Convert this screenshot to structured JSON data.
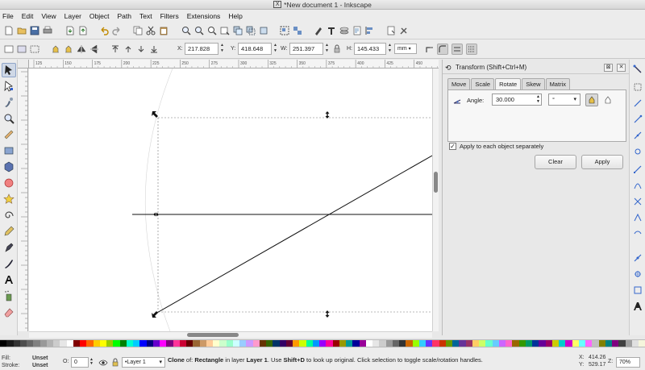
{
  "window": {
    "title": "*New document 1 - Inkscape"
  },
  "menu": [
    "File",
    "Edit",
    "View",
    "Layer",
    "Object",
    "Path",
    "Text",
    "Filters",
    "Extensions",
    "Help"
  ],
  "controls": {
    "x_label": "X:",
    "x_value": "217.828",
    "y_label": "Y:",
    "y_value": "418.648",
    "w_label": "W:",
    "w_value": "251.397",
    "h_label": "H:",
    "h_value": "145.433",
    "unit": "mm"
  },
  "ruler": {
    "h_ticks": [
      "125",
      "150",
      "175",
      "200",
      "225",
      "250",
      "275",
      "300",
      "325",
      "350",
      "375",
      "400",
      "425",
      "450"
    ]
  },
  "dock": {
    "title": "Transform (Shift+Ctrl+M)",
    "tabs": [
      "Move",
      "Scale",
      "Rotate",
      "Skew",
      "Matrix"
    ],
    "active_tab": "Rotate",
    "angle_label": "Angle:",
    "angle_value": "30.000",
    "angle_unit": "°",
    "apply_each_label": "Apply to each object separately",
    "apply_each_checked": true,
    "clear_label": "Clear",
    "apply_label": "Apply"
  },
  "palette": [
    "#000000",
    "#1a1a1a",
    "#333333",
    "#4d4d4d",
    "#666666",
    "#808080",
    "#999999",
    "#b3b3b3",
    "#cccccc",
    "#e6e6e6",
    "#ffffff",
    "#800000",
    "#ff0000",
    "#ff6600",
    "#ffcc00",
    "#ffff00",
    "#99cc00",
    "#00ff00",
    "#008000",
    "#00ffcc",
    "#00ccff",
    "#0000ff",
    "#000080",
    "#6600cc",
    "#ff00ff",
    "#800080",
    "#ff3399",
    "#cc0033",
    "#660000",
    "#996633",
    "#cc9966",
    "#ffcc99",
    "#ffffcc",
    "#ccffcc",
    "#99ffcc",
    "#ccffff",
    "#99ccff",
    "#cc99ff",
    "#ff99cc",
    "#663300",
    "#336600",
    "#003366",
    "#330066",
    "#660033",
    "#ff9900",
    "#ccff00",
    "#00ff99",
    "#0099ff",
    "#9900ff",
    "#ff0099",
    "#990000",
    "#999900",
    "#009999",
    "#000099",
    "#990099",
    "#ffffff",
    "#e6e6e6",
    "#cccccc",
    "#999999",
    "#666666",
    "#333333",
    "#cc6600",
    "#99ff00",
    "#33ccff",
    "#6633ff",
    "#ff3366",
    "#cc3300",
    "#669900",
    "#006699",
    "#663399",
    "#993366",
    "#ffcc66",
    "#ccff66",
    "#66ffcc",
    "#66ccff",
    "#cc66ff",
    "#ff66cc",
    "#996600",
    "#339900",
    "#009966",
    "#003399",
    "#660099",
    "#990066",
    "#cccc00",
    "#00cccc",
    "#cc00cc",
    "#ffff66",
    "#66ffff",
    "#ff66ff",
    "#c0c0c0",
    "#808000",
    "#008080",
    "#800080",
    "#404040",
    "#a0a0a0",
    "#e0e0e0",
    "#f5f5dc"
  ],
  "status": {
    "fill_label": "Fill:",
    "fill_value": "Unset",
    "stroke_label": "Stroke:",
    "stroke_value": "Unset",
    "opacity_label": "O:",
    "opacity_value": "0",
    "layer": "•Layer 1",
    "msg_pre": "Clone",
    "msg_1": " of: ",
    "msg_obj": "Rectangle",
    "msg_2": "  in layer ",
    "msg_layer": "Layer 1",
    "msg_3": ". Use ",
    "msg_key": "Shift+D",
    "msg_4": " to look up original. Click selection to toggle scale/rotation handles.",
    "cursor_x_label": "X:",
    "cursor_x": "414.26",
    "cursor_y_label": "Y:",
    "cursor_y": "529.17",
    "zoom_label": "Z:",
    "zoom": "70%"
  }
}
